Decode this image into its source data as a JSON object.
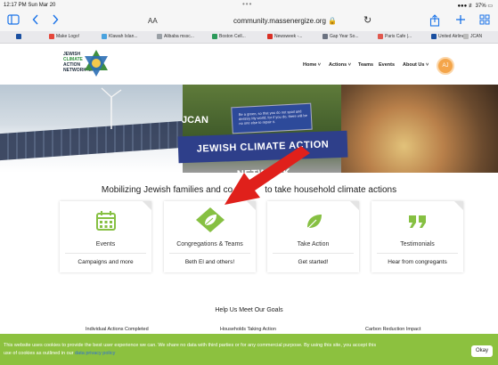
{
  "status_bar": {
    "time": "12:17 PM  Sun Mar 20",
    "dots": "•••",
    "right": "●●● ≢ 37% ▭"
  },
  "browser": {
    "aa": "AA",
    "url": "community.massenergize.org 🔒",
    "reload": "↻",
    "tabs": [
      {
        "label": "Make Logo!",
        "color": "#e5473b"
      },
      {
        "label": "Klawah Islan...",
        "color": "#4aa3df"
      },
      {
        "label": "Alibaba mssc...",
        "color": "#9aa0a6"
      },
      {
        "label": "Boston Cell...",
        "color": "#2c9a5a"
      },
      {
        "label": "Newsweek -...",
        "color": "#d93025"
      },
      {
        "label": "Gap Year So...",
        "color": "#6b7280"
      },
      {
        "label": "Paris Cafe |...",
        "color": "#e0584e"
      },
      {
        "label": "United Airlines",
        "color": "#1a4fa0"
      },
      {
        "label": "JCAN",
        "color": "#bbbbbb"
      },
      {
        "label": "JCAN",
        "color": "#9aa0a6"
      }
    ]
  },
  "site": {
    "logo": {
      "line1": "JEWISH",
      "line2": "CLIMATE",
      "line3": "ACTION",
      "line4": "NETWORK MA"
    },
    "nav": [
      {
        "label": "Home ˅"
      },
      {
        "label": "Actions ˅"
      },
      {
        "label": "Teams"
      },
      {
        "label": "Events"
      },
      {
        "label": "About Us ˅"
      }
    ],
    "avatar": "AJ"
  },
  "hero": {
    "jcan_label": "JCAN",
    "banner": "JEWISH CLIMATE ACTION NETWORK",
    "sign_text": "Be a green, so that you do not spoil and destroy My world; for if you do, there will be no one else to repair it."
  },
  "tagline": "Mobilizing Jewish families and co",
  "tagline_end": "to take household climate actions",
  "cards": [
    {
      "title": "Events",
      "sub": "Campaigns and more",
      "icon": "calendar-icon",
      "color": "#86c042"
    },
    {
      "title": "Congregations & Teams",
      "sub": "Beth El and others!",
      "icon": "leaf-diamond-icon",
      "color": "#86c042"
    },
    {
      "title": "Take Action",
      "sub": "Get started!",
      "icon": "leaf-icon",
      "color": "#86c042"
    },
    {
      "title": "Testimonials",
      "sub": "Hear from congregants",
      "icon": "quote-icon",
      "color": "#86c042"
    }
  ],
  "goals": {
    "heading": "Help Us Meet Our Goals",
    "metrics": [
      "Individual Actions Completed",
      "Households Taking Action",
      "Carbon Reduction Impact"
    ]
  },
  "cookie": {
    "text": "This website uses cookies to provide the best user experience we can. We share no data with third parties or for any commercial purpose. By using this site, you accept this use of cookies as outlined in our ",
    "link": "data privacy policy",
    "button": "Okay"
  },
  "colors": {
    "brand_green": "#86c042",
    "cookie_green": "#8cc13f",
    "arrow_red": "#e0201b"
  }
}
